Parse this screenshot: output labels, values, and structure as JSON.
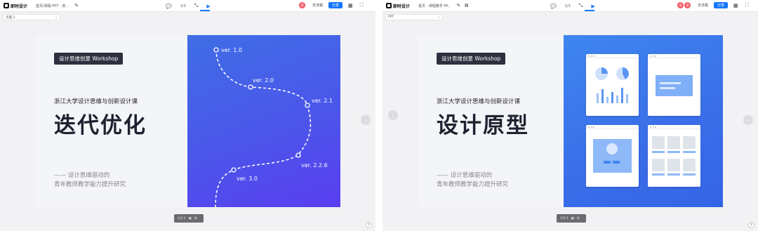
{
  "app": {
    "name": "即时设计"
  },
  "panels": [
    {
      "breadcrumb": "首页/课程 PPT - 迭...",
      "pager": "1/3",
      "avatar_letter": "设",
      "save_label": "无法载",
      "share_label": "分享",
      "subbar_label": "页面 2",
      "slide": {
        "badge": "设计思维创意 Workshop",
        "course": "浙江大学设计思维与创新设计课",
        "title": "迭代优化",
        "subtitle_line1": "—— 设计思维驱动的",
        "subtitle_line2": "青年教师教学能力提升研究",
        "versions": [
          "ver. 1.0",
          "ver. 2.0",
          "ver. 2.1",
          "ver. 2.2.6",
          "ver. 3.0"
        ]
      },
      "bottombar": "1/3 1"
    },
    {
      "breadcrumb": "首页 · 课程教学 PP...",
      "pager": "1/3",
      "avatar_letter": "设",
      "save_label": "无法载",
      "share_label": "分享",
      "subbar_label": "PPT",
      "slide": {
        "badge": "设计思维创意 Workshop",
        "course": "浙江大学设计思维与创新设计课",
        "title": "设计原型",
        "subtitle_line1": "—— 设计思维驱动的",
        "subtitle_line2": "青年教师教学能力提升研究"
      },
      "bottombar": "1/3 1"
    }
  ],
  "icons": {
    "comment": "💬",
    "pen": "✎",
    "play": "▶",
    "fullscreen": "⛶",
    "nav_left": "‹",
    "nav_right": "›",
    "help": "?"
  },
  "colors": {
    "accent": "#1677ff",
    "slide_visual_left": "#4b56ea",
    "slide_visual_right": "#3a6ee8",
    "avatar": "#f0545f"
  }
}
